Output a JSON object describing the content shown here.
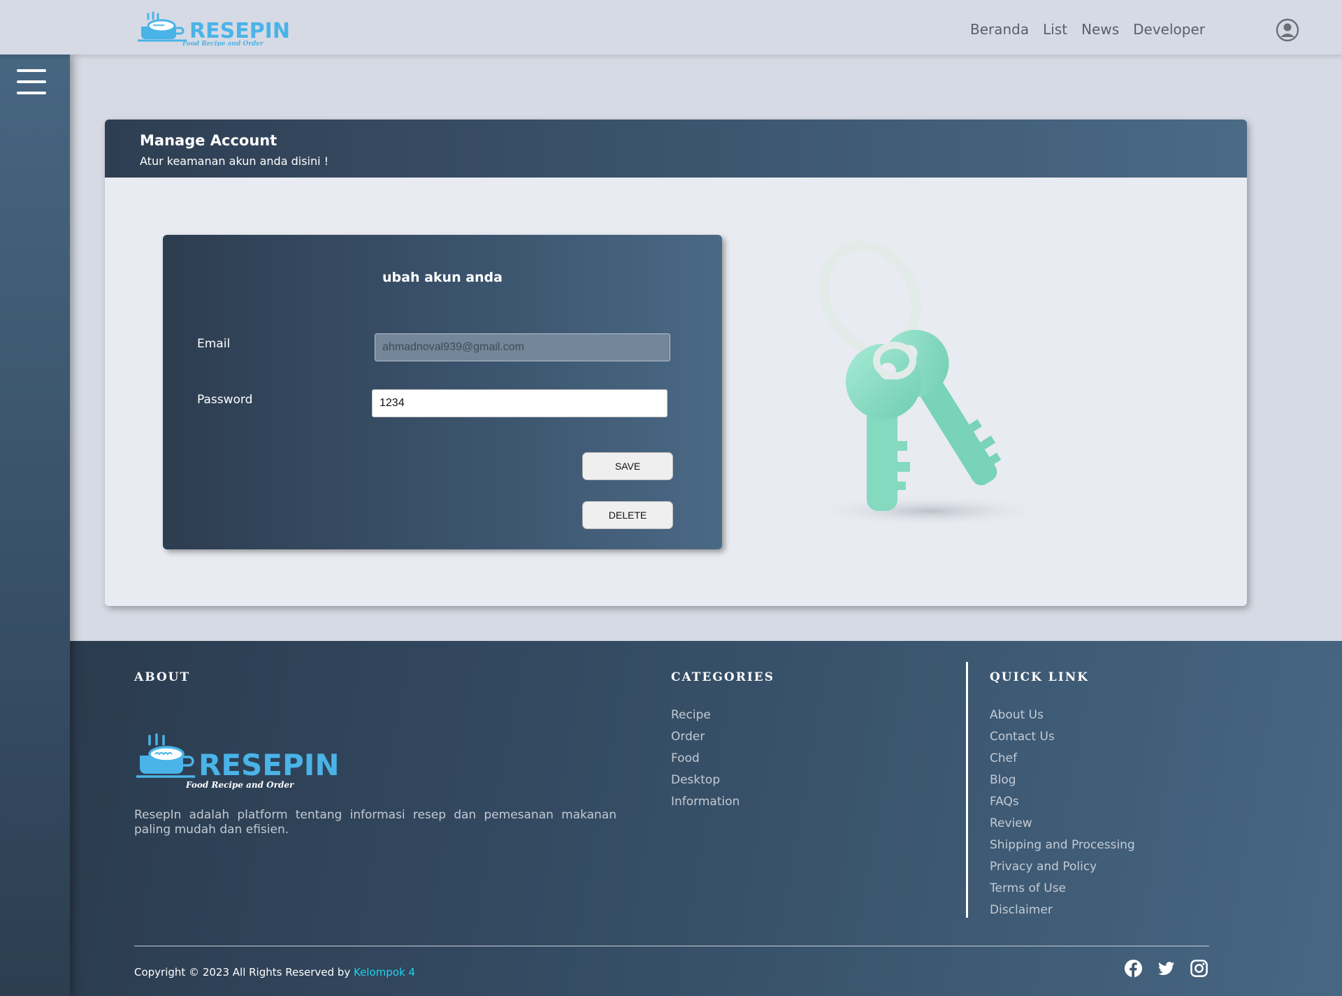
{
  "navbar": {
    "brand": "RESEPIN",
    "tagline": "Food Recipe and Order",
    "links": [
      {
        "label": "Beranda"
      },
      {
        "label": "List"
      },
      {
        "label": "News"
      },
      {
        "label": "Developer"
      }
    ]
  },
  "header": {
    "title": "Manage Account",
    "subtitle": "Atur keamanan akun anda disini !"
  },
  "form": {
    "title": "ubah akun anda",
    "email_label": "Email",
    "email_value": "ahmadnoval939@gmail.com",
    "password_label": "Password",
    "password_value": "1234",
    "save_label": "SAVE",
    "delete_label": "DELETE"
  },
  "footer": {
    "about": {
      "heading": "ABOUT",
      "brand": "RESEPIN",
      "tagline": "Food Recipe and Order",
      "text": "ResepIn adalah platform tentang informasi resep dan pemesanan makanan paling mudah dan efisien."
    },
    "categories": {
      "heading": "CATEGORIES",
      "items": [
        "Recipe",
        "Order",
        "Food",
        "Desktop",
        "Information"
      ]
    },
    "quick_link": {
      "heading": "QUICK LINK",
      "items": [
        "About Us",
        "Contact Us",
        "Chef",
        "Blog",
        "FAQs",
        "Review",
        "Shipping and Processing",
        "Privacy and Policy",
        "Terms of Use",
        "Disclaimer"
      ]
    },
    "copyright": "Copyright © 2023 All Rights Reserved by",
    "credit": "Kelompok 4",
    "socials": [
      "facebook-icon",
      "twitter-icon",
      "instagram-icon"
    ]
  },
  "colors": {
    "accent": "#4ab3e8",
    "credit": "#1ed3f0",
    "key": "#8edcc5"
  }
}
